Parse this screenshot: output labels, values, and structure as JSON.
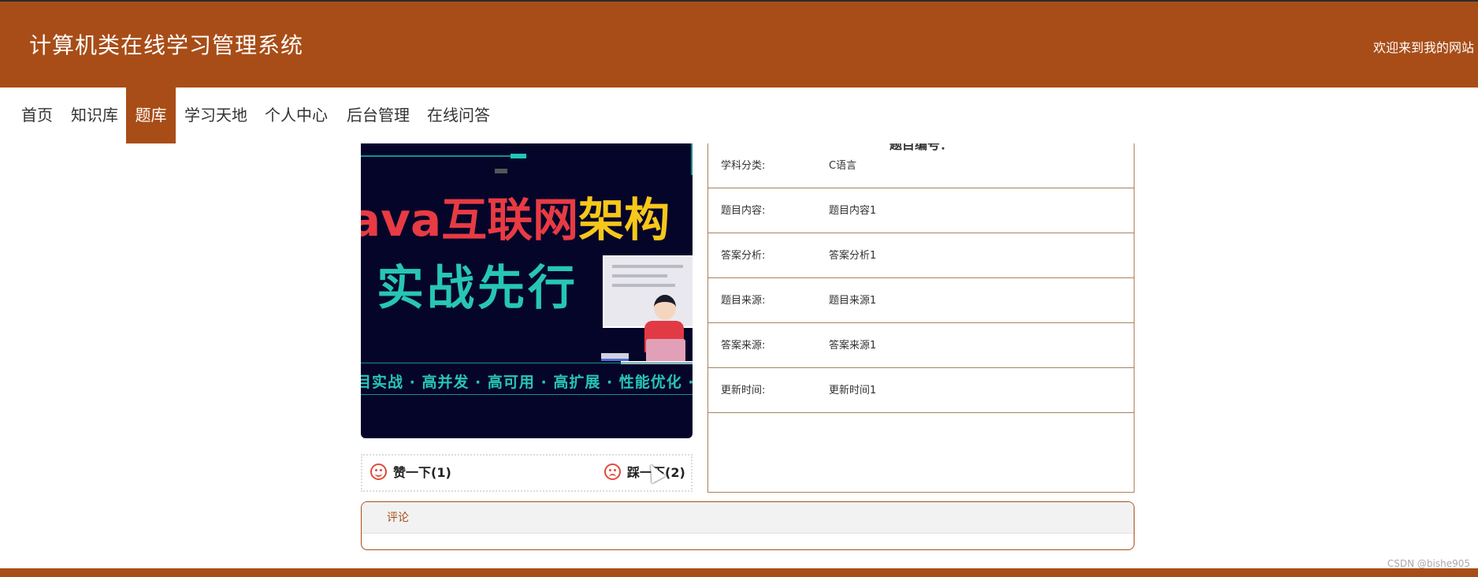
{
  "header": {
    "site_title": "计算机类在线学习管理系统",
    "welcome": "欢迎来到我的网站"
  },
  "nav": {
    "items": [
      {
        "label": "首页"
      },
      {
        "label": "知识库"
      },
      {
        "label": "题库",
        "active": true
      },
      {
        "label": "学习天地"
      },
      {
        "label": "个人中心"
      },
      {
        "label": "后台管理"
      },
      {
        "label": "在线问答"
      }
    ]
  },
  "banner": {
    "line1_red_a": "ava互联网",
    "line1_yellow": "架构",
    "line2": "实战先行",
    "line3": "目实战 · 高并发 · 高可用 · 高扩展 · 性能优化 · 源"
  },
  "vote": {
    "like_label": "赞一下(1)",
    "like_icon": "smile-icon",
    "dislike_label": "踩一下(2)",
    "dislike_icon": "frown-icon"
  },
  "detail": {
    "title": "题目编号：",
    "rows": [
      {
        "label": "学科分类:",
        "value": "C语言"
      },
      {
        "label": "题目内容:",
        "value": "题目内容1"
      },
      {
        "label": "答案分析:",
        "value": "答案分析1"
      },
      {
        "label": "题目来源:",
        "value": "题目来源1"
      },
      {
        "label": "答案来源:",
        "value": "答案来源1"
      },
      {
        "label": "更新时间:",
        "value": "更新时间1"
      }
    ]
  },
  "comment": {
    "tab_label": "评论"
  },
  "watermark": "CSDN @bishe905",
  "colors": {
    "brand": "#a84d18",
    "border": "#a8825d",
    "icon": "#e04a3a"
  }
}
